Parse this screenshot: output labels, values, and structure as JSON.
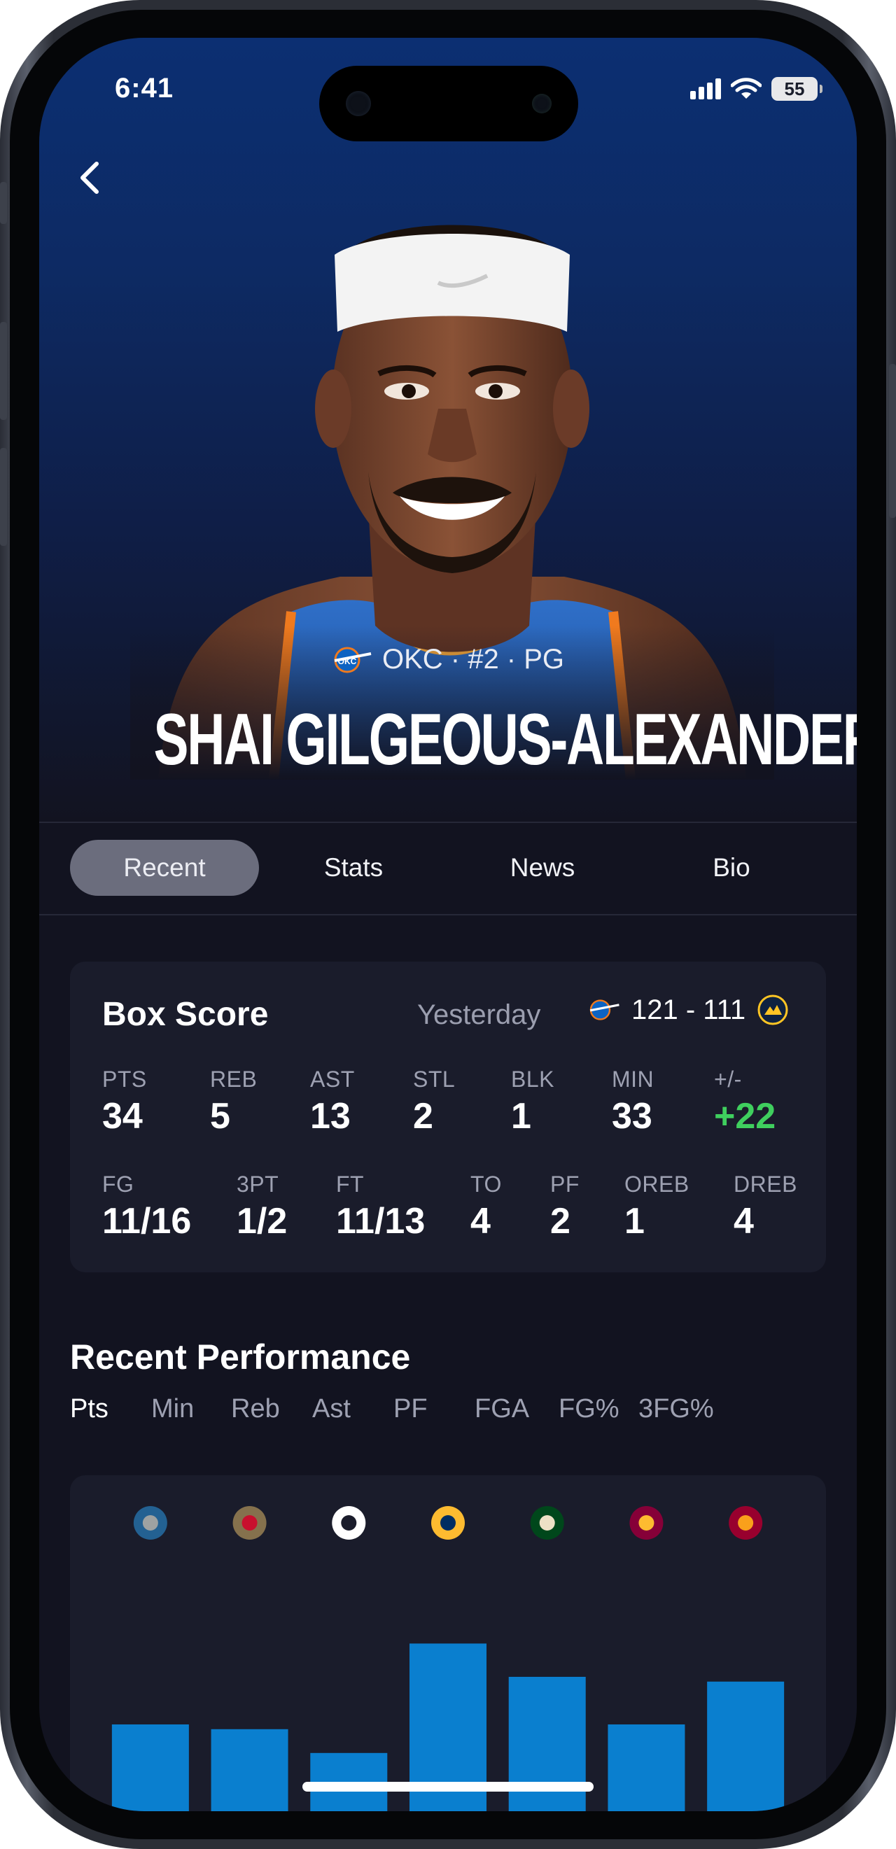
{
  "status_bar": {
    "time": "6:41",
    "battery": "55"
  },
  "header": {
    "team_abbr": "OKC",
    "team_line": "OKC · #2 · PG",
    "player_name": "SHAI GILGEOUS-ALEXANDER"
  },
  "tabs": [
    {
      "label": "Recent",
      "active": true
    },
    {
      "label": "Stats",
      "active": false
    },
    {
      "label": "News",
      "active": false
    },
    {
      "label": "Bio",
      "active": false
    }
  ],
  "box_score": {
    "title": "Box Score",
    "date": "Yesterday",
    "score": "121 - 111",
    "home_team_logo": "okc-logo-icon",
    "away_team_logo": "nuggets-logo-icon",
    "row1": [
      {
        "label": "PTS",
        "value": "34"
      },
      {
        "label": "REB",
        "value": "5"
      },
      {
        "label": "AST",
        "value": "13"
      },
      {
        "label": "STL",
        "value": "2"
      },
      {
        "label": "BLK",
        "value": "1"
      },
      {
        "label": "MIN",
        "value": "33"
      },
      {
        "label": "+/-",
        "value": "+22",
        "color": "#3fcf5e"
      }
    ],
    "row2": [
      {
        "label": "FG",
        "value": "11/16"
      },
      {
        "label": "3PT",
        "value": "1/2"
      },
      {
        "label": "FT",
        "value": "11/13"
      },
      {
        "label": "TO",
        "value": "4"
      },
      {
        "label": "PF",
        "value": "2"
      },
      {
        "label": "OREB",
        "value": "1"
      },
      {
        "label": "DREB",
        "value": "4"
      }
    ]
  },
  "recent_performance": {
    "title": "Recent Performance",
    "filters": [
      "Pts",
      "Min",
      "Reb",
      "Ast",
      "PF",
      "FGA",
      "FG%",
      "3FG%"
    ],
    "active_filter": "Pts"
  },
  "chart_data": {
    "type": "bar",
    "categories": [
      "timberwolves-logo-icon",
      "pelicans-logo-icon",
      "raptors-logo-icon",
      "pacers-logo-icon",
      "bucks-logo-icon",
      "cavaliers-logo-icon",
      "heat-logo-icon"
    ],
    "values": [
      30,
      29,
      24,
      47,
      40,
      30,
      39
    ],
    "ylim": [
      0,
      50
    ],
    "bar_color": "#0a7fcf",
    "data_labels": true,
    "grid": false,
    "title": "",
    "xlabel": "",
    "ylabel": ""
  },
  "colors": {
    "accent_blue": "#0a7fcf",
    "positive_green": "#3fcf5e",
    "background": "#121320",
    "card": "#1a1c2b"
  }
}
